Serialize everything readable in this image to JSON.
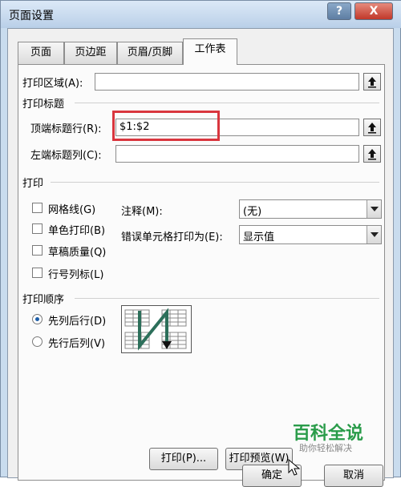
{
  "window": {
    "title": "页面设置",
    "help": "?",
    "close": "X"
  },
  "tabs": [
    {
      "label": "页面"
    },
    {
      "label": "页边距"
    },
    {
      "label": "页眉/页脚"
    },
    {
      "label": "工作表"
    }
  ],
  "print_area": {
    "label": "打印区域(A):",
    "value": ""
  },
  "print_titles": {
    "header": "打印标题",
    "rows_label": "顶端标题行(R):",
    "rows_value": "$1:$2",
    "cols_label": "左端标题列(C):",
    "cols_value": ""
  },
  "print": {
    "header": "打印",
    "checkboxes": [
      {
        "label": "网格线(G)",
        "checked": false
      },
      {
        "label": "单色打印(B)",
        "checked": false
      },
      {
        "label": "草稿质量(Q)",
        "checked": false
      },
      {
        "label": "行号列标(L)",
        "checked": false
      }
    ],
    "comments_label": "注释(M):",
    "comments_value": "(无)",
    "errors_label": "错误单元格打印为(E):",
    "errors_value": "显示值"
  },
  "order": {
    "header": "打印顺序",
    "options": [
      {
        "label": "先列后行(D)",
        "selected": true
      },
      {
        "label": "先行后列(V)",
        "selected": false
      }
    ]
  },
  "buttons": {
    "print": "打印(P)...",
    "preview": "打印预览(W)",
    "ok": "确定",
    "cancel": "取消"
  },
  "watermark": {
    "title": "百科全说",
    "subtitle": "助你轻松解决"
  },
  "colors": {
    "highlight": "#d9363e",
    "accent": "#1d5ea8"
  }
}
